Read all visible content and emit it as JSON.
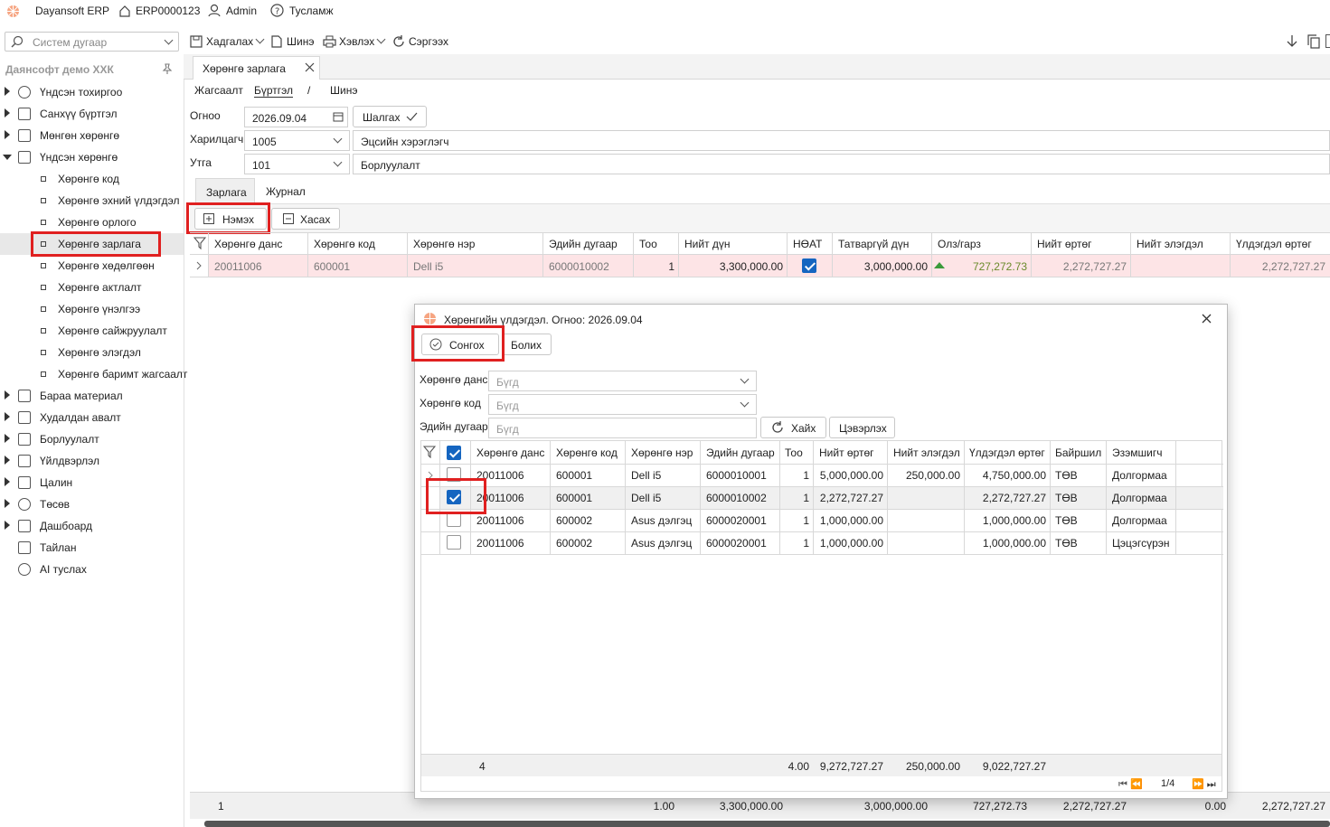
{
  "app": {
    "name": "Dayansoft ERP",
    "code": "ERP0000123",
    "user": "Admin",
    "help": "Тусламж"
  },
  "toolbar": {
    "search_placeholder": "Систем дугаар",
    "save": "Хадгалах",
    "new": "Шинэ",
    "print": "Хэвлэх",
    "refresh": "Сэргээх"
  },
  "sidebar": {
    "company": "Даянсофт демо ХХК",
    "items": [
      {
        "label": "Үндсэн тохиргоо",
        "icon": "gear-icon"
      },
      {
        "label": "Санхүү бүртгэл",
        "icon": "ledger-icon"
      },
      {
        "label": "Мөнгөн хөрөнгө",
        "icon": "cash-icon"
      },
      {
        "label": "Үндсэн хөрөнгө",
        "icon": "building-icon"
      }
    ],
    "subitems": [
      "Хөрөнгө код",
      "Хөрөнгө эхний үлдэгдэл",
      "Хөрөнгө орлого",
      "Хөрөнгө зарлага",
      "Хөрөнгө хөдөлгөөн",
      "Хөрөнгө актлалт",
      "Хөрөнгө үнэлгээ",
      "Хөрөнгө сайжруулалт",
      "Хөрөнгө элэгдэл",
      "Хөрөнгө баримт жагсаалт"
    ],
    "items2": [
      {
        "label": "Бараа материал",
        "icon": "box-icon"
      },
      {
        "label": "Худалдан авалт",
        "icon": "cart-icon"
      },
      {
        "label": "Борлуулалт",
        "icon": "sales-icon"
      },
      {
        "label": "Үйлдвэрлэл",
        "icon": "factory-icon"
      },
      {
        "label": "Цалин",
        "icon": "wallet-icon"
      },
      {
        "label": "Төсөв",
        "icon": "pie-icon"
      },
      {
        "label": "Дашбоард",
        "icon": "chart-icon"
      },
      {
        "label": "Тайлан",
        "icon": "report-icon"
      },
      {
        "label": "AI туслах",
        "icon": "ai-icon"
      }
    ]
  },
  "doc_tab": "Хөрөнгө зарлага",
  "breadcrumb": {
    "list": "Жагсаалт",
    "register": "Бүртгэл",
    "sep": "/",
    "new": "Шинэ"
  },
  "form": {
    "date_label": "Огноо",
    "date_value": "2026.09.04",
    "check_btn": "Шалгах",
    "partner_label": "Харилцагч",
    "partner_value": "1005",
    "partner_name": "Эцсийн хэрэглэгч",
    "account_label": "Утга",
    "account_value": "101",
    "account_name": "Борлуулалт"
  },
  "subtabs": {
    "expense": "Зарлага",
    "journal": "Журнал"
  },
  "actions": {
    "add": "Нэмэх",
    "remove": "Хасах"
  },
  "main_grid": {
    "headers": [
      "Хөрөнгө данс",
      "Хөрөнгө код",
      "Хөрөнгө нэр",
      "Эдийн дугаар",
      "Тоо",
      "Нийт дүн",
      "НӨАТ",
      "Татваргүй дүн",
      "Олз/гарз",
      "Нийт өртөг",
      "Нийт элэгдэл",
      "Үлдэгдэл өртөг"
    ],
    "row": [
      "20011006",
      "600001",
      "Dell i5",
      "6000010002",
      "1",
      "3,300,000.00",
      "",
      "3,000,000.00",
      "727,272.73",
      "2,272,727.27",
      "",
      "2,272,727.27"
    ],
    "footer": [
      "1",
      "1.00",
      "3,300,000.00",
      "3,000,000.00",
      "727,272.73",
      "2,272,727.27",
      "0.00",
      "2,272,727.27"
    ]
  },
  "dialog": {
    "title": "Хөрөнгийн үлдэгдэл. Огноо: 2026.09.04",
    "select": "Сонгох",
    "cancel": "Болих",
    "f_account": "Хөрөнгө данс",
    "f_code": "Хөрөнгө код",
    "f_serial": "Эдийн дугаар",
    "all": "Бүгд",
    "search": "Хайх",
    "clear": "Цэвэрлэх",
    "headers": [
      "Хөрөнгө данс",
      "Хөрөнгө код",
      "Хөрөнгө нэр",
      "Эдийн дугаар",
      "Тоо",
      "Нийт өртөг",
      "Нийт элэгдэл",
      "Үлдэгдэл өртөг",
      "Байршил",
      "Эзэмшигч"
    ],
    "rows": [
      {
        "checked": false,
        "c": [
          "20011006",
          "600001",
          "Dell i5",
          "6000010001",
          "1",
          "5,000,000.00",
          "250,000.00",
          "4,750,000.00",
          "ТӨВ",
          "Долгормаа"
        ]
      },
      {
        "checked": true,
        "c": [
          "20011006",
          "600001",
          "Dell i5",
          "6000010002",
          "1",
          "2,272,727.27",
          "",
          "2,272,727.27",
          "ТӨВ",
          "Долгормаа"
        ]
      },
      {
        "checked": false,
        "c": [
          "20011006",
          "600002",
          "Asus дэлгэц",
          "6000020001",
          "1",
          "1,000,000.00",
          "",
          "1,000,000.00",
          "ТӨВ",
          "Долгормаа"
        ]
      },
      {
        "checked": false,
        "c": [
          "20011006",
          "600002",
          "Asus дэлгэц",
          "6000020001",
          "1",
          "1,000,000.00",
          "",
          "1,000,000.00",
          "ТӨВ",
          "Цэцэгсүрэн"
        ]
      }
    ],
    "footer": {
      "count": "4",
      "qty": "4.00",
      "cost": "9,272,727.27",
      "dep": "250,000.00",
      "rem": "9,022,727.27"
    },
    "pager": "1/4"
  },
  "colors": {
    "accent": "#1565c0",
    "highlight": "#e02020",
    "row_pink": "#fde4e6",
    "gain": "#3a8a3a"
  }
}
